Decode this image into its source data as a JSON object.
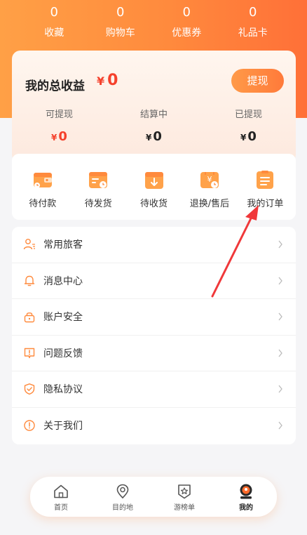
{
  "stats": [
    {
      "value": "0",
      "label": "收藏"
    },
    {
      "value": "0",
      "label": "购物车"
    },
    {
      "value": "0",
      "label": "优惠券"
    },
    {
      "value": "0",
      "label": "礼品卡"
    }
  ],
  "earnings": {
    "title": "我的总收益",
    "currency": "¥",
    "total": "0",
    "withdraw_label": "提现",
    "cols": [
      {
        "label": "可提现",
        "currency": "¥",
        "value": "0"
      },
      {
        "label": "结算中",
        "currency": "¥",
        "value": "0"
      },
      {
        "label": "已提现",
        "currency": "¥",
        "value": "0"
      }
    ]
  },
  "orders": [
    {
      "label": "待付款",
      "icon": "wallet-icon"
    },
    {
      "label": "待发货",
      "icon": "box-clock-icon"
    },
    {
      "label": "待收货",
      "icon": "box-down-icon"
    },
    {
      "label": "退换/售后",
      "icon": "yen-bag-icon"
    },
    {
      "label": "我的订单",
      "icon": "order-list-icon"
    }
  ],
  "menu": [
    {
      "label": "常用旅客",
      "icon": "user-list-icon"
    },
    {
      "label": "消息中心",
      "icon": "bell-icon"
    },
    {
      "label": "账户安全",
      "icon": "lock-icon"
    },
    {
      "label": "问题反馈",
      "icon": "feedback-icon"
    },
    {
      "label": "隐私协议",
      "icon": "shield-icon"
    },
    {
      "label": "关于我们",
      "icon": "info-icon"
    }
  ],
  "tabs": [
    {
      "label": "首页",
      "icon": "home-icon",
      "active": false
    },
    {
      "label": "目的地",
      "icon": "location-icon",
      "active": false
    },
    {
      "label": "游榜单",
      "icon": "star-badge-icon",
      "active": false
    },
    {
      "label": "我的",
      "icon": "profile-icon",
      "active": true
    }
  ],
  "colors": {
    "accent": "#ff8a3d",
    "price_red": "#f5412c"
  }
}
